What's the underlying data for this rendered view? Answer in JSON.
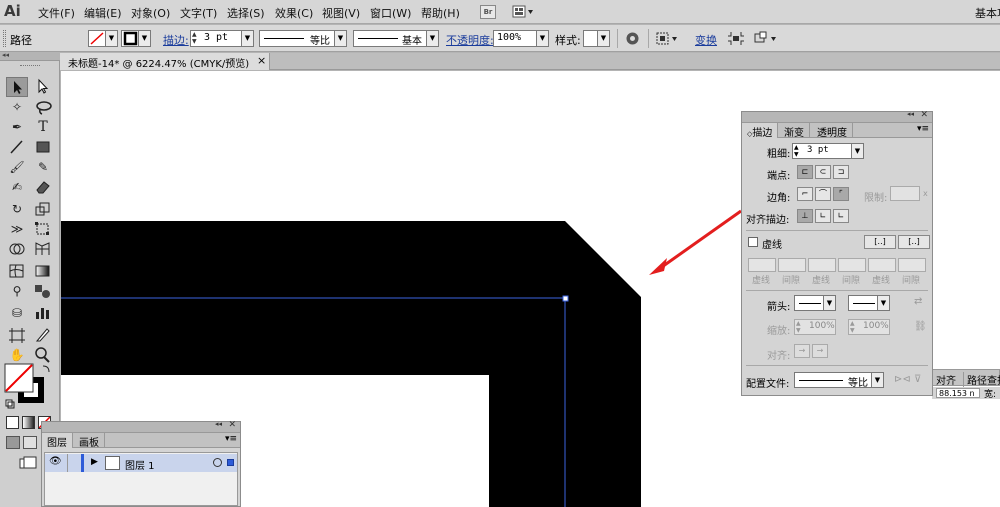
{
  "app": {
    "logo": "Ai"
  },
  "menu": [
    "文件(F)",
    "编辑(E)",
    "对象(O)",
    "文字(T)",
    "选择(S)",
    "效果(C)",
    "视图(V)",
    "窗口(W)",
    "帮助(H)"
  ],
  "menubar_right": {
    "bridge": "Br",
    "workspace": "基本功"
  },
  "control": {
    "selection": "路径",
    "stroke_label": "描边:",
    "stroke_weight": "3 pt",
    "profile": "等比",
    "brush": "基本",
    "opacity_label": "不透明度:",
    "opacity": "100%",
    "style_label": "样式:",
    "transform_label": "变换"
  },
  "document_tab": {
    "title": "未标题-14* @ 6224.47% (CMYK/预览)",
    "close": "×"
  },
  "stroke_panel": {
    "tabs": [
      "描边",
      "渐变",
      "透明度"
    ],
    "weight_label": "粗细:",
    "weight": "3 pt",
    "cap_label": "端点:",
    "corner_label": "边角:",
    "limit_label": "限制:",
    "align_label": "对齐描边:",
    "dashed_label": "虚线",
    "dash_cells": [
      "虚线",
      "间隙",
      "虚线",
      "间隙",
      "虚线",
      "间隙"
    ],
    "arrow_label": "箭头:",
    "scale_label": "缩放:",
    "scale1": "100%",
    "scale2": "100%",
    "align2_label": "对齐:",
    "profile_label": "配置文件:",
    "profile_value": "等比"
  },
  "side_tabs": {
    "tab1": "对齐",
    "tab2": "路径查找",
    "field": "88.153 n",
    "field_label": "宽:"
  },
  "layers_panel": {
    "tabs": [
      "图层",
      "画板"
    ],
    "layer_name": "图层 1"
  },
  "colors": {
    "accent": "#2d5bd8",
    "arrow": "#e31e1e",
    "shape": "#000000"
  }
}
